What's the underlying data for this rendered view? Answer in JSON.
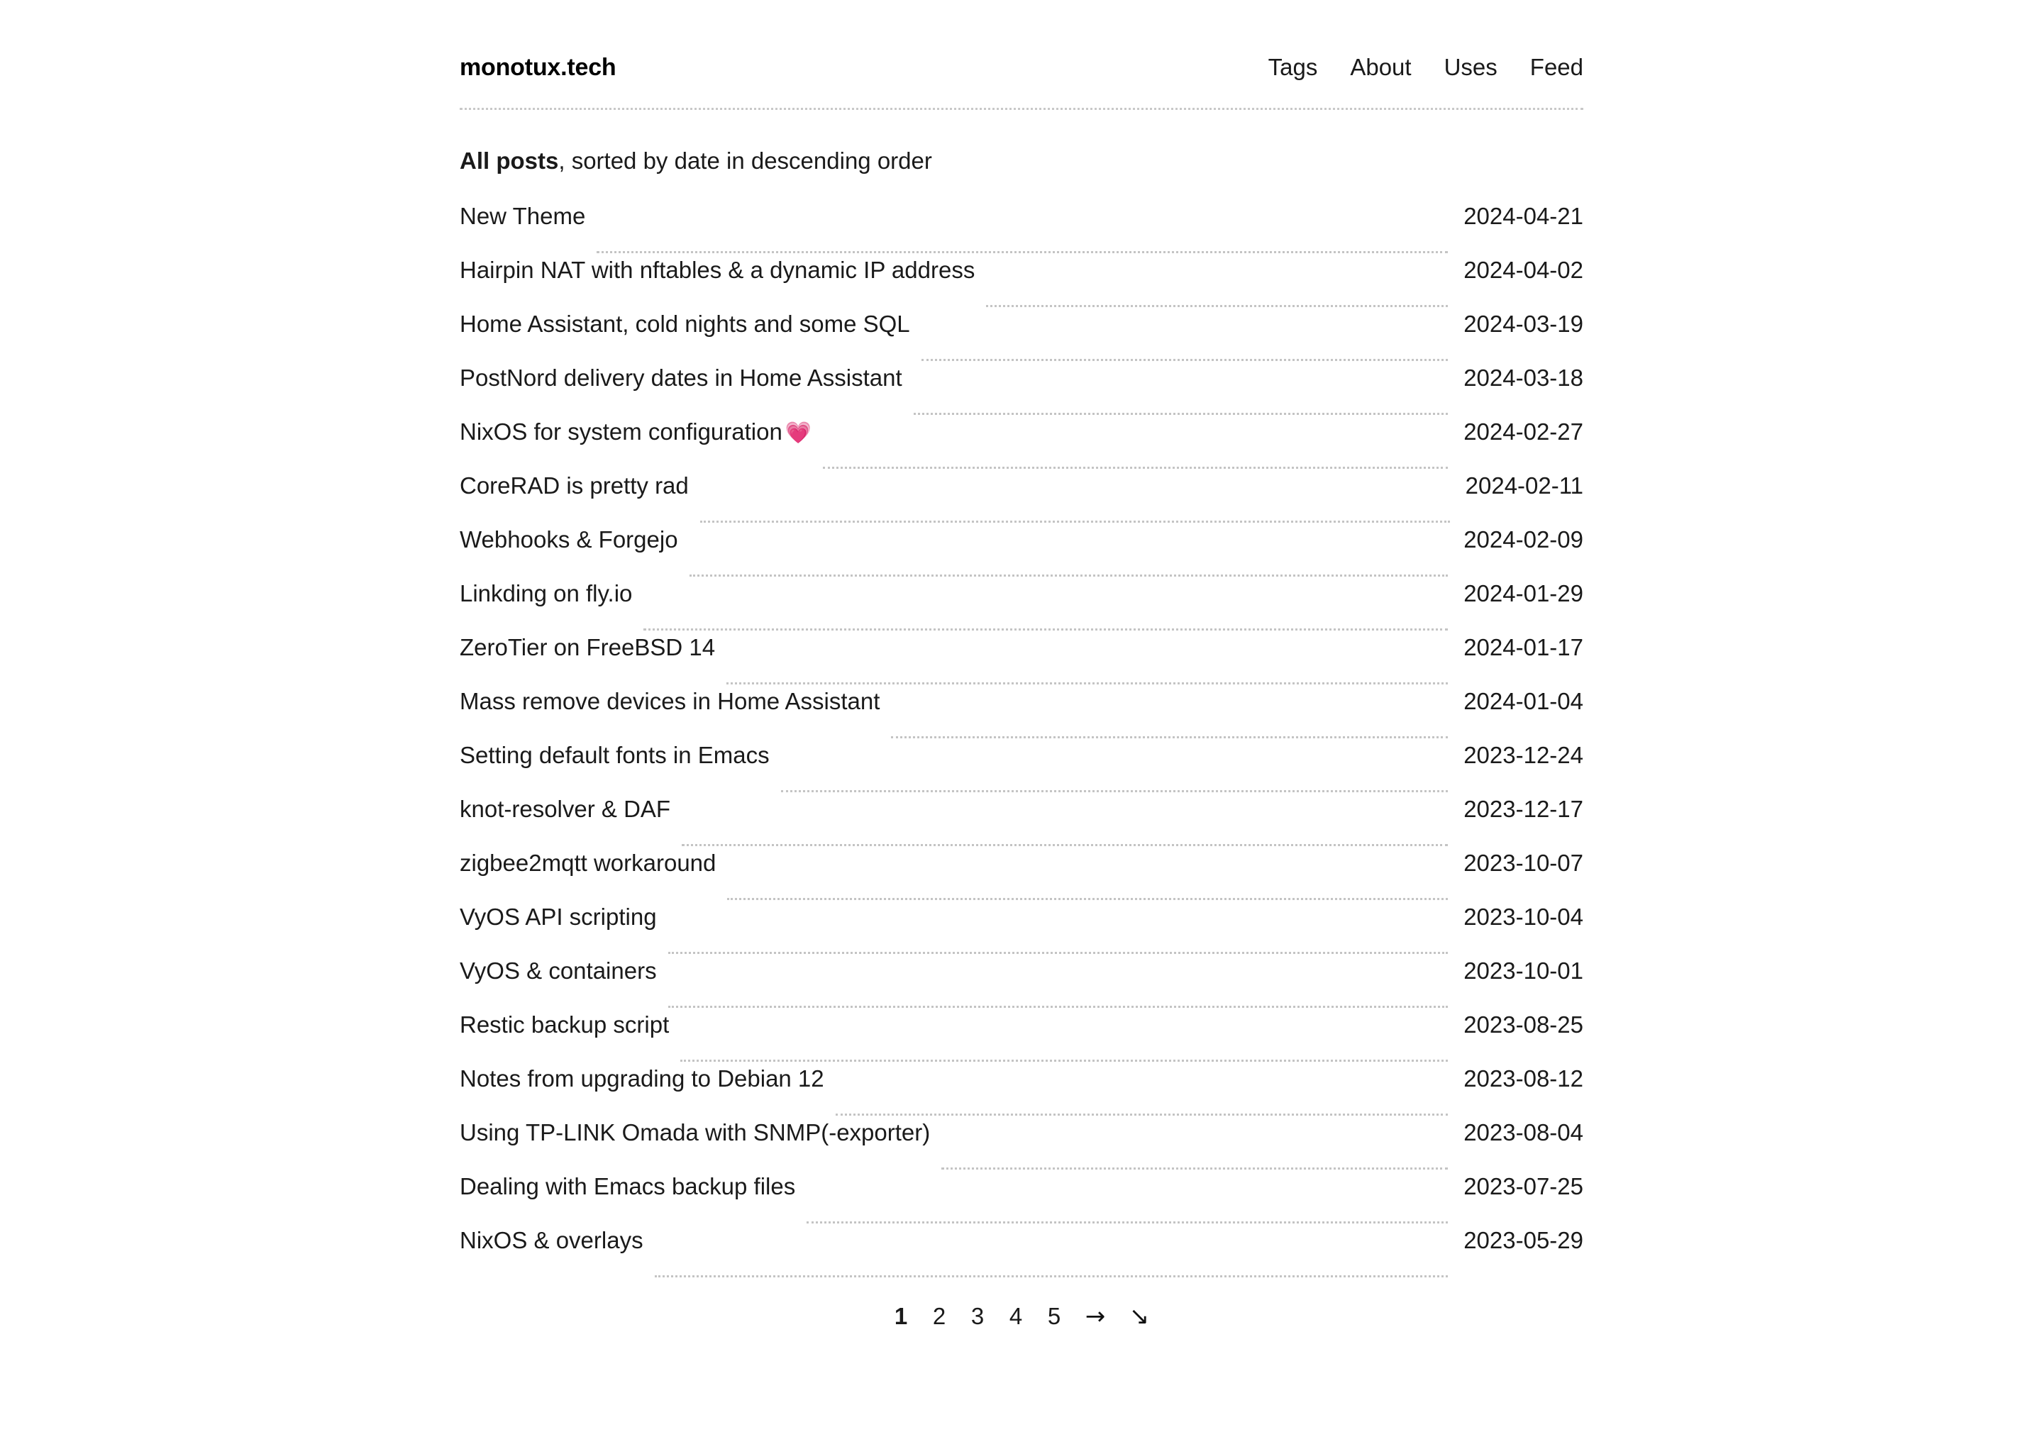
{
  "header": {
    "logo": "monotux.tech",
    "nav": [
      {
        "label": "Tags"
      },
      {
        "label": "About"
      },
      {
        "label": "Uses"
      },
      {
        "label": "Feed"
      }
    ]
  },
  "intro": {
    "strong": "All posts",
    "rest": ", sorted by date in descending order"
  },
  "posts": [
    {
      "title": "New Theme",
      "date": "2024-04-21",
      "emoji": ""
    },
    {
      "title": "Hairpin NAT with nftables & a dynamic IP address",
      "date": "2024-04-02",
      "emoji": ""
    },
    {
      "title": "Home Assistant, cold nights and some SQL",
      "date": "2024-03-19",
      "emoji": ""
    },
    {
      "title": "PostNord delivery dates in Home Assistant",
      "date": "2024-03-18",
      "emoji": ""
    },
    {
      "title": "NixOS for system configuration",
      "date": "2024-02-27",
      "emoji": "💗"
    },
    {
      "title": "CoreRAD is pretty rad",
      "date": "2024-02-11",
      "emoji": ""
    },
    {
      "title": "Webhooks & Forgejo",
      "date": "2024-02-09",
      "emoji": ""
    },
    {
      "title": "Linkding on fly.io",
      "date": "2024-01-29",
      "emoji": ""
    },
    {
      "title": "ZeroTier on FreeBSD 14",
      "date": "2024-01-17",
      "emoji": ""
    },
    {
      "title": "Mass remove devices in Home Assistant",
      "date": "2024-01-04",
      "emoji": ""
    },
    {
      "title": "Setting default fonts in Emacs",
      "date": "2023-12-24",
      "emoji": ""
    },
    {
      "title": "knot-resolver & DAF",
      "date": "2023-12-17",
      "emoji": ""
    },
    {
      "title": "zigbee2mqtt workaround",
      "date": "2023-10-07",
      "emoji": ""
    },
    {
      "title": "VyOS API scripting",
      "date": "2023-10-04",
      "emoji": ""
    },
    {
      "title": "VyOS & containers",
      "date": "2023-10-01",
      "emoji": ""
    },
    {
      "title": "Restic backup script",
      "date": "2023-08-25",
      "emoji": ""
    },
    {
      "title": "Notes from upgrading to Debian 12",
      "date": "2023-08-12",
      "emoji": ""
    },
    {
      "title": "Using TP-LINK Omada with SNMP(-exporter)",
      "date": "2023-08-04",
      "emoji": ""
    },
    {
      "title": "Dealing with Emacs backup files",
      "date": "2023-07-25",
      "emoji": ""
    },
    {
      "title": "NixOS & overlays",
      "date": "2023-05-29",
      "emoji": ""
    }
  ],
  "pagination": {
    "pages": [
      {
        "label": "1",
        "current": true
      },
      {
        "label": "2",
        "current": false
      },
      {
        "label": "3",
        "current": false
      },
      {
        "label": "4",
        "current": false
      },
      {
        "label": "5",
        "current": false
      }
    ],
    "next_arrow": "→",
    "last_arrow": "↘"
  },
  "colors": {
    "text": "#1a1a1a",
    "dotted_rule": "#c4c4c4",
    "heart": "#ff3dad"
  }
}
